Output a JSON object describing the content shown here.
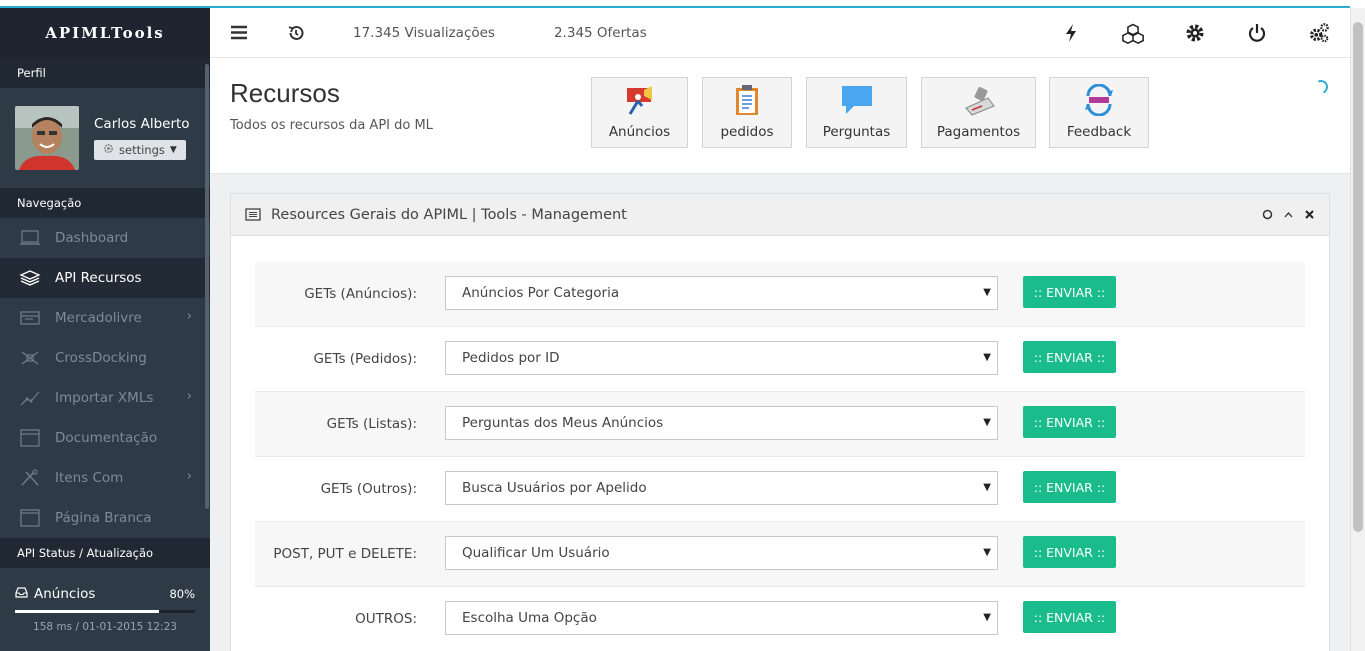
{
  "app": {
    "brand": "APIMLTools"
  },
  "sidebar": {
    "profile_heading": "Perfil",
    "user_name": "Carlos Alberto",
    "settings_label": "settings",
    "nav_heading": "Navegação",
    "items": [
      {
        "label": "Dashboard",
        "icon": "laptop-icon",
        "active": false
      },
      {
        "label": "API Recursos",
        "icon": "layers-icon",
        "active": true
      },
      {
        "label": "Mercadolivre",
        "icon": "browser-icon",
        "active": false
      },
      {
        "label": "CrossDocking",
        "icon": "crossdocking-icon",
        "active": false
      },
      {
        "label": "Importar XMLs",
        "icon": "chart-icon",
        "active": false
      },
      {
        "label": "Documentação",
        "icon": "document-icon",
        "active": false
      },
      {
        "label": "Itens Com",
        "icon": "tools-icon",
        "active": false
      },
      {
        "label": "Página Branca",
        "icon": "blank-page-icon",
        "active": false
      }
    ],
    "status_heading": "API Status / Atualização",
    "status": {
      "label": "Anúncios",
      "percent": "80%",
      "progress": 0.8,
      "timestamp": "158 ms / 01-01-2015 12:23"
    }
  },
  "topnav": {
    "views": "17.345 Visualizações",
    "offers": "2.345 Ofertas",
    "right_icons": [
      "bolt-icon",
      "cubes-icon",
      "gear-icon",
      "power-icon",
      "gears-icon"
    ]
  },
  "header": {
    "title": "Recursos",
    "subtitle": "Todos os recursos da API do ML",
    "quick_buttons": [
      "Anúncios",
      "pedidos",
      "Perguntas",
      "Pagamentos",
      "Feedback"
    ]
  },
  "panel": {
    "title": "Resources Gerais do APIML | Tools - Management",
    "rows": [
      {
        "label": "GETs (Anúncios):",
        "selected": "Anúncios Por Categoria",
        "button": ":: ENVIAR ::"
      },
      {
        "label": "GETs (Pedidos):",
        "selected": "Pedidos por ID",
        "button": ":: ENVIAR ::"
      },
      {
        "label": "GETs (Listas):",
        "selected": "Perguntas dos Meus Anúncios",
        "button": ":: ENVIAR ::"
      },
      {
        "label": "GETs (Outros):",
        "selected": "Busca Usuários por Apelido",
        "button": ":: ENVIAR ::"
      },
      {
        "label": "POST, PUT e DELETE:",
        "selected": "Qualificar Um Usuário",
        "button": ":: ENVIAR ::"
      },
      {
        "label": "OUTROS:",
        "selected": "Escolha Uma Opção",
        "button": ":: ENVIAR ::"
      }
    ]
  },
  "colors": {
    "accent": "#1abc8c",
    "sidebar_bg": "#2f3a47",
    "top_accent": "#2dacd1"
  }
}
